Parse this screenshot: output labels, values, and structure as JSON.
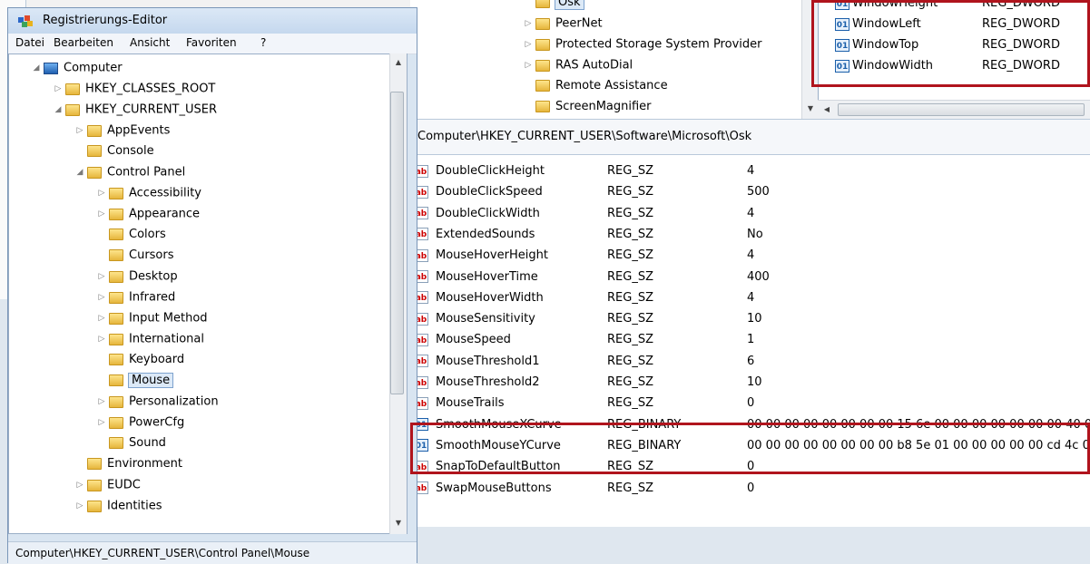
{
  "window": {
    "title": "Registrierungs-Editor"
  },
  "menu": [
    "Datei",
    "Bearbeiten",
    "Ansicht",
    "Favoriten",
    "?"
  ],
  "tree": [
    {
      "label": "Computer",
      "level": 0,
      "exp": "open",
      "icon": "computer"
    },
    {
      "label": "HKEY_CLASSES_ROOT",
      "level": 1,
      "exp": "closed"
    },
    {
      "label": "HKEY_CURRENT_USER",
      "level": 1,
      "exp": "open"
    },
    {
      "label": "AppEvents",
      "level": 2,
      "exp": "closed"
    },
    {
      "label": "Console",
      "level": 2,
      "exp": "none"
    },
    {
      "label": "Control Panel",
      "level": 2,
      "exp": "open"
    },
    {
      "label": "Accessibility",
      "level": 3,
      "exp": "closed"
    },
    {
      "label": "Appearance",
      "level": 3,
      "exp": "closed"
    },
    {
      "label": "Colors",
      "level": 3,
      "exp": "none"
    },
    {
      "label": "Cursors",
      "level": 3,
      "exp": "none"
    },
    {
      "label": "Desktop",
      "level": 3,
      "exp": "closed"
    },
    {
      "label": "Infrared",
      "level": 3,
      "exp": "closed"
    },
    {
      "label": "Input Method",
      "level": 3,
      "exp": "closed"
    },
    {
      "label": "International",
      "level": 3,
      "exp": "closed"
    },
    {
      "label": "Keyboard",
      "level": 3,
      "exp": "none"
    },
    {
      "label": "Mouse",
      "level": 3,
      "exp": "none",
      "selected": true
    },
    {
      "label": "Personalization",
      "level": 3,
      "exp": "closed"
    },
    {
      "label": "PowerCfg",
      "level": 3,
      "exp": "closed"
    },
    {
      "label": "Sound",
      "level": 3,
      "exp": "none"
    },
    {
      "label": "Environment",
      "level": 2,
      "exp": "none"
    },
    {
      "label": "EUDC",
      "level": 2,
      "exp": "closed"
    },
    {
      "label": "Identities",
      "level": 2,
      "exp": "closed"
    }
  ],
  "status_left": "Computer\\HKEY_CURRENT_USER\\Control Panel\\Mouse",
  "top_tree": [
    {
      "label": "Osk",
      "exp": "none",
      "selected": true
    },
    {
      "label": "PeerNet",
      "exp": "closed"
    },
    {
      "label": "Protected Storage System Provider",
      "exp": "closed"
    },
    {
      "label": "RAS AutoDial",
      "exp": "closed"
    },
    {
      "label": "Remote Assistance",
      "exp": "none"
    },
    {
      "label": "ScreenMagnifier",
      "exp": "none"
    }
  ],
  "top_values": [
    {
      "name": "WindowHeight",
      "type": "REG_DWORD"
    },
    {
      "name": "WindowLeft",
      "type": "REG_DWORD"
    },
    {
      "name": "WindowTop",
      "type": "REG_DWORD"
    },
    {
      "name": "WindowWidth",
      "type": "REG_DWORD"
    }
  ],
  "top_path": "Computer\\HKEY_CURRENT_USER\\Software\\Microsoft\\Osk",
  "values": [
    {
      "name": "DoubleClickHeight",
      "type": "REG_SZ",
      "data": "4",
      "kind": "sz"
    },
    {
      "name": "DoubleClickSpeed",
      "type": "REG_SZ",
      "data": "500",
      "kind": "sz"
    },
    {
      "name": "DoubleClickWidth",
      "type": "REG_SZ",
      "data": "4",
      "kind": "sz"
    },
    {
      "name": "ExtendedSounds",
      "type": "REG_SZ",
      "data": "No",
      "kind": "sz"
    },
    {
      "name": "MouseHoverHeight",
      "type": "REG_SZ",
      "data": "4",
      "kind": "sz"
    },
    {
      "name": "MouseHoverTime",
      "type": "REG_SZ",
      "data": "400",
      "kind": "sz"
    },
    {
      "name": "MouseHoverWidth",
      "type": "REG_SZ",
      "data": "4",
      "kind": "sz"
    },
    {
      "name": "MouseSensitivity",
      "type": "REG_SZ",
      "data": "10",
      "kind": "sz"
    },
    {
      "name": "MouseSpeed",
      "type": "REG_SZ",
      "data": "1",
      "kind": "sz"
    },
    {
      "name": "MouseThreshold1",
      "type": "REG_SZ",
      "data": "6",
      "kind": "sz"
    },
    {
      "name": "MouseThreshold2",
      "type": "REG_SZ",
      "data": "10",
      "kind": "sz"
    },
    {
      "name": "MouseTrails",
      "type": "REG_SZ",
      "data": "0",
      "kind": "sz"
    },
    {
      "name": "SmoothMouseXCurve",
      "type": "REG_BINARY",
      "data": "00 00 00 00 00 00 00 00 15 6e 00 00 00 00 00 00 00 40 0...",
      "kind": "bin"
    },
    {
      "name": "SmoothMouseYCurve",
      "type": "REG_BINARY",
      "data": "00 00 00 00 00 00 00 00 b8 5e 01 00 00 00 00 00 cd 4c 0...",
      "kind": "bin"
    },
    {
      "name": "SnapToDefaultButton",
      "type": "REG_SZ",
      "data": "0",
      "kind": "sz"
    },
    {
      "name": "SwapMouseButtons",
      "type": "REG_SZ",
      "data": "0",
      "kind": "sz"
    }
  ],
  "icons": {
    "string_value": "ab",
    "binary_value": "011 110"
  },
  "colors": {
    "highlight": "#b0141d",
    "selection": "#dce9f7"
  }
}
